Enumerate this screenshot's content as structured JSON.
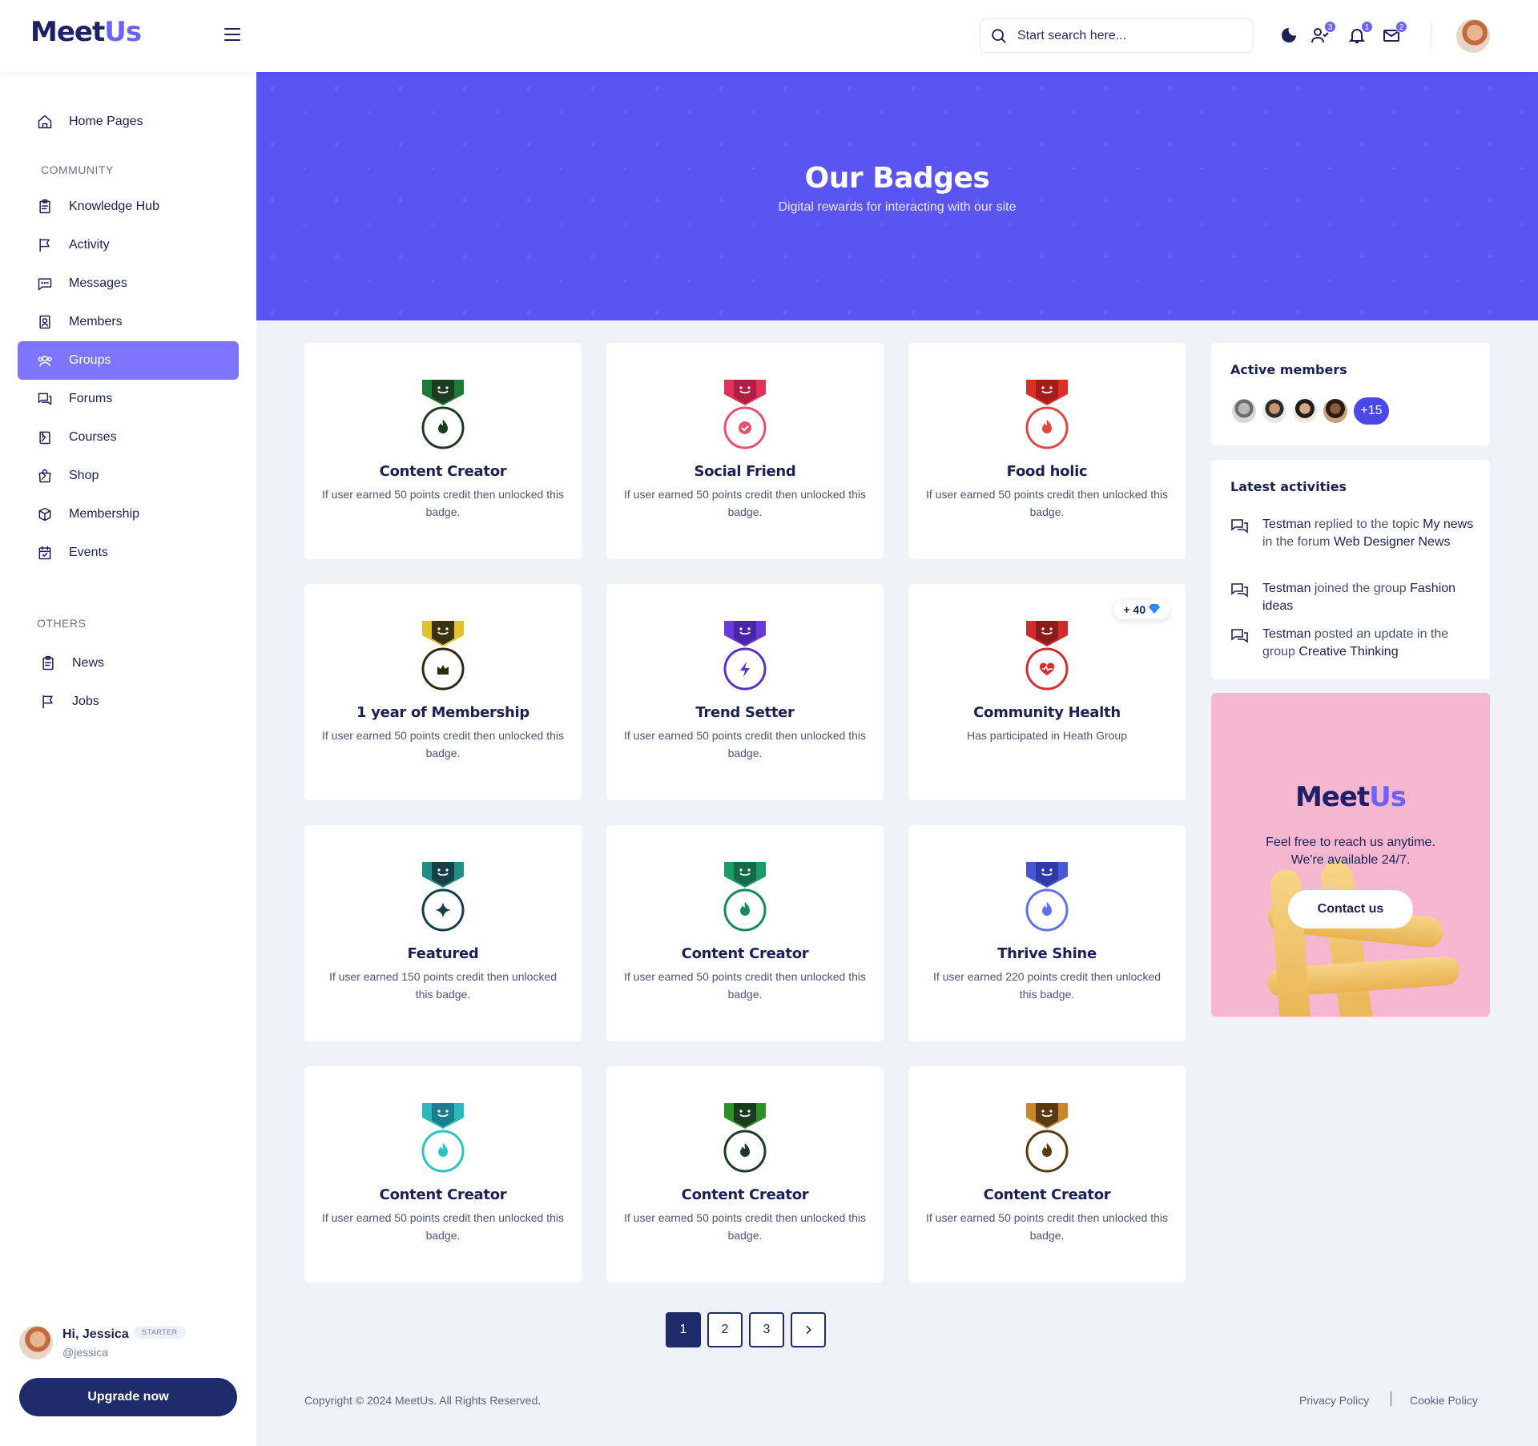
{
  "brand": {
    "name_a": "Meet",
    "name_b": "Us"
  },
  "header": {
    "search_placeholder": "Start search here...",
    "badges": {
      "friends": "3",
      "notifications": "1",
      "messages": "2"
    }
  },
  "sidebar": {
    "home": "Home Pages",
    "section_community": "COMMUNITY",
    "items": [
      {
        "label": "Knowledge Hub",
        "icon": "clipboard-icon"
      },
      {
        "label": "Activity",
        "icon": "flag-icon"
      },
      {
        "label": "Messages",
        "icon": "chat-icon"
      },
      {
        "label": "Members",
        "icon": "id-card-icon"
      },
      {
        "label": "Groups",
        "icon": "users-icon",
        "active": true
      },
      {
        "label": "Forums",
        "icon": "forum-icon"
      },
      {
        "label": "Courses",
        "icon": "book-icon"
      },
      {
        "label": "Shop",
        "icon": "bag-icon"
      },
      {
        "label": "Membership",
        "icon": "box-icon"
      },
      {
        "label": "Events",
        "icon": "calendar-icon"
      }
    ],
    "section_others": "OTHERS",
    "others": [
      {
        "label": "News",
        "icon": "clipboard-icon"
      },
      {
        "label": "Jobs",
        "icon": "flag-icon"
      }
    ],
    "user": {
      "greeting": "Hi, Jessica",
      "handle": "@jessica",
      "tag": "STARTER"
    },
    "upgrade_label": "Upgrade now"
  },
  "hero": {
    "title": "Our Badges",
    "subtitle": "Digital rewards for interacting with our site"
  },
  "badges": [
    {
      "title": "Content Creator",
      "desc": "If user earned 50 points credit then unlocked this badge.",
      "color": "#1f7a3a",
      "dark": "#1d3b1f",
      "ring": "#1d3b1f",
      "icon": "flame-icon"
    },
    {
      "title": "Social Friend",
      "desc": "If user earned 50 points credit then unlocked this badge.",
      "color": "#e0335c",
      "dark": "#b01e45",
      "ring": "#e8506f",
      "icon": "check-badge-icon"
    },
    {
      "title": "Food holic",
      "desc": "If user earned 50 points credit then unlocked this badge.",
      "color": "#d9302c",
      "dark": "#a51d1a",
      "ring": "#e0483f",
      "icon": "flame-icon"
    },
    {
      "title": "1 year of Membership",
      "desc": "If user earned 50 points credit then unlocked this badge.",
      "color": "#e3c12b",
      "dark": "#3d3310",
      "ring": "#2f2a10",
      "icon": "crown-icon"
    },
    {
      "title": "Trend Setter",
      "desc": "If user earned 50 points credit then unlocked this badge.",
      "color": "#6b3bd9",
      "dark": "#4a25a8",
      "ring": "#5b33c4",
      "icon": "bolt-icon"
    },
    {
      "title": "Community Health",
      "desc": "Has participated in Heath Group",
      "color": "#d32b2b",
      "dark": "#8f1a1a",
      "ring": "#cf3030",
      "icon": "heart-icon",
      "points": "+ 40"
    },
    {
      "title": "Featured",
      "desc": "If user earned 150 points credit then unlocked this badge.",
      "color": "#1f8e86",
      "dark": "#173f4a",
      "ring": "#173f4a",
      "icon": "sparkle-icon"
    },
    {
      "title": "Content Creator",
      "desc": "If user earned 50 points credit then unlocked this badge.",
      "color": "#1b9a6c",
      "dark": "#136b4b",
      "ring": "#158a5e",
      "icon": "flame-icon"
    },
    {
      "title": "Thrive Shine",
      "desc": "If user earned 220 points credit then unlocked this badge.",
      "color": "#4657d8",
      "dark": "#2e3aa5",
      "ring": "#5f72e6",
      "icon": "flame-icon"
    },
    {
      "title": "Content Creator",
      "desc": "If user earned 50 points credit then unlocked this badge.",
      "color": "#2bb9b9",
      "dark": "#197f8a",
      "ring": "#2cc2c0",
      "icon": "flame-icon"
    },
    {
      "title": "Content Creator",
      "desc": "If user earned 50 points credit then unlocked this badge.",
      "color": "#2f8f2a",
      "dark": "#1d3b1f",
      "ring": "#1d3b1f",
      "icon": "flame-icon"
    },
    {
      "title": "Content Creator",
      "desc": "If user earned 50 points credit then unlocked this badge.",
      "color": "#c9862b",
      "dark": "#5a3a14",
      "ring": "#5a3a14",
      "icon": "flame-icon"
    }
  ],
  "pagination": {
    "pages": [
      "1",
      "2",
      "3"
    ],
    "current": "1"
  },
  "footer": {
    "copyright": "Copyright © 2024 MeetUs. All Rights Reserved.",
    "privacy": "Privacy Policy",
    "cookie": "Cookie Policy"
  },
  "right": {
    "active_title": "Active members",
    "more_count": "+15",
    "activities_title": "Latest activities",
    "activities": [
      {
        "user": "Testman",
        "text": " replied to the topic ",
        "target": "My news",
        "text2": " in the forum ",
        "target2": "Web Designer News"
      },
      {
        "user": "Testman",
        "text": " joined the group ",
        "target": "Fashion ideas",
        "text2": "",
        "target2": ""
      },
      {
        "user": "Testman",
        "text": " posted an update in the group ",
        "target": "Creative Thinking",
        "text2": "",
        "target2": ""
      }
    ],
    "promo_text_1": "Feel free to reach us anytime.",
    "promo_text_2": "We're available 24/7.",
    "contact_label": "Contact us"
  }
}
